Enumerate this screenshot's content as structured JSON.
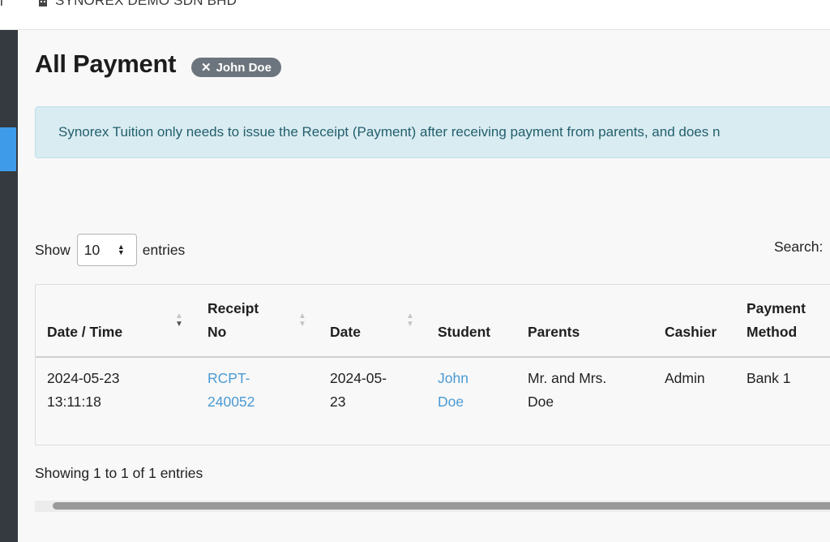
{
  "topbar": {
    "left_partial": "i",
    "company": "SYNOREX DEMO SDN BHD"
  },
  "page": {
    "title": "All Payment",
    "filter_chip": "John Doe"
  },
  "alert": {
    "text": "Synorex Tuition only needs to issue the Receipt (Payment) after receiving payment from parents, and does n"
  },
  "table_controls": {
    "show_label": "Show",
    "page_length": "10",
    "entries_label": "entries",
    "search_label": "Search:"
  },
  "table": {
    "headers": {
      "datetime": "Date / Time",
      "receipt_l1": "Receipt",
      "receipt_l2": "No",
      "date": "Date",
      "student": "Student",
      "parents": "Parents",
      "cashier": "Cashier",
      "method_l1": "Payment",
      "method_l2": "Method"
    },
    "rows": [
      {
        "datetime_l1": "2024-05-23",
        "datetime_l2": "13:11:18",
        "receipt_l1": "RCPT-",
        "receipt_l2": "240052",
        "date_l1": "2024-05-",
        "date_l2": "23",
        "student_l1": "John",
        "student_l2": "Doe",
        "parents_l1": "Mr. and Mrs.",
        "parents_l2": "Doe",
        "cashier": "Admin",
        "method": "Bank 1"
      }
    ]
  },
  "info": "Showing 1 to 1 of 1 entries",
  "colors": {
    "sidebar": "#343a40",
    "sidebar_active": "#3d9be9",
    "chip": "#6c757d",
    "alert_bg": "#d9ecf2",
    "link": "#4a9ad4"
  }
}
